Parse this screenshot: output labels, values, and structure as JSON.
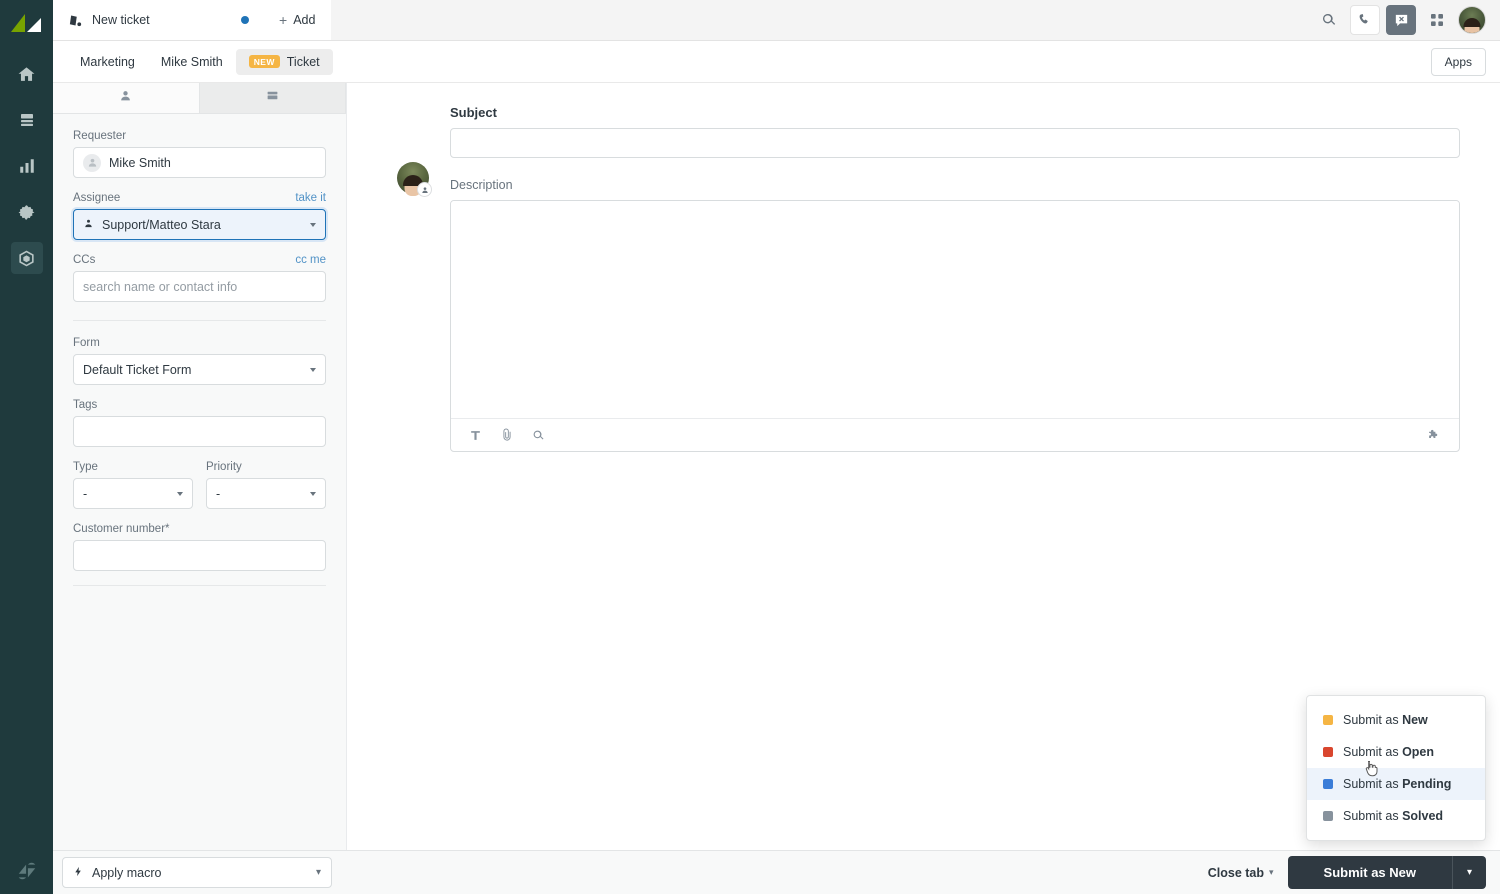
{
  "rail": {
    "logo_name": "zendesk-logo",
    "items": [
      {
        "name": "home",
        "label": "Home",
        "active": false
      },
      {
        "name": "views",
        "label": "Views",
        "active": false
      },
      {
        "name": "reporting",
        "label": "Reporting",
        "active": false
      },
      {
        "name": "admin",
        "label": "Admin",
        "active": false
      },
      {
        "name": "apps",
        "label": "Apps",
        "active": true
      }
    ],
    "bottom_logo": "zendesk-z-logo"
  },
  "topbar": {
    "tab": {
      "label": "New ticket",
      "icon": "ticket-icon",
      "unsaved": true
    },
    "add_label": "Add",
    "actions": [
      {
        "name": "search-icon",
        "label": "Search"
      },
      {
        "name": "phone-icon",
        "label": "Talk"
      },
      {
        "name": "chat-unavailable-icon",
        "label": "Chat"
      },
      {
        "name": "apps-grid-icon",
        "label": "Products"
      },
      {
        "name": "user-avatar",
        "label": "Profile"
      }
    ]
  },
  "breadcrumb": {
    "items": [
      {
        "label": "Marketing",
        "badge": null,
        "current": false
      },
      {
        "label": "Mike Smith",
        "badge": null,
        "current": false
      },
      {
        "label": "Ticket",
        "badge": "NEW",
        "current": true
      }
    ],
    "apps_button": "Apps"
  },
  "panel": {
    "tabs": [
      {
        "name": "requester-tab",
        "icon": "person-icon",
        "active": true
      },
      {
        "name": "ticket-tab",
        "icon": "ticket-card-icon",
        "active": false
      }
    ],
    "fields": {
      "requester": {
        "label": "Requester",
        "value": "Mike Smith"
      },
      "assignee": {
        "label": "Assignee",
        "action_label": "take it",
        "value": "Support/Matteo Stara"
      },
      "ccs": {
        "label": "CCs",
        "action_label": "cc me",
        "value": "",
        "placeholder": "search name or contact info"
      },
      "form": {
        "label": "Form",
        "value": "Default Ticket Form"
      },
      "tags": {
        "label": "Tags",
        "value": ""
      },
      "type": {
        "label": "Type",
        "value": "-"
      },
      "priority": {
        "label": "Priority",
        "value": "-"
      },
      "customer_number": {
        "label": "Customer number*",
        "value": ""
      }
    }
  },
  "compose": {
    "subject": {
      "label": "Subject",
      "value": "",
      "placeholder": ""
    },
    "description": {
      "label": "Description",
      "value": "",
      "placeholder": ""
    },
    "toolbar": [
      {
        "name": "text-format-icon",
        "label": "Text formatting"
      },
      {
        "name": "attachment-icon",
        "label": "Attach file"
      },
      {
        "name": "search-content-icon",
        "label": "Search"
      },
      {
        "name": "apps-puzzle-icon",
        "label": "Apps"
      }
    ]
  },
  "footer": {
    "macro_label": "Apply macro",
    "macro_icon": "lightning-icon",
    "close_tab_label": "Close tab",
    "submit_label": "Submit as New"
  },
  "status_menu": {
    "open": true,
    "items": [
      {
        "prefix": "Submit as ",
        "status": "New",
        "color": "#f5b544",
        "hover": false
      },
      {
        "prefix": "Submit as ",
        "status": "Open",
        "color": "#d9462e",
        "hover": false
      },
      {
        "prefix": "Submit as ",
        "status": "Pending",
        "color": "#3b7dd8",
        "hover": true
      },
      {
        "prefix": "Submit as ",
        "status": "Solved",
        "color": "#87929d",
        "hover": false
      }
    ]
  },
  "colors": {
    "rail_bg": "#1f3a3d",
    "accent_blue": "#1f73b7",
    "submit_dark": "#2f3941",
    "badge_amber": "#f5b544"
  }
}
